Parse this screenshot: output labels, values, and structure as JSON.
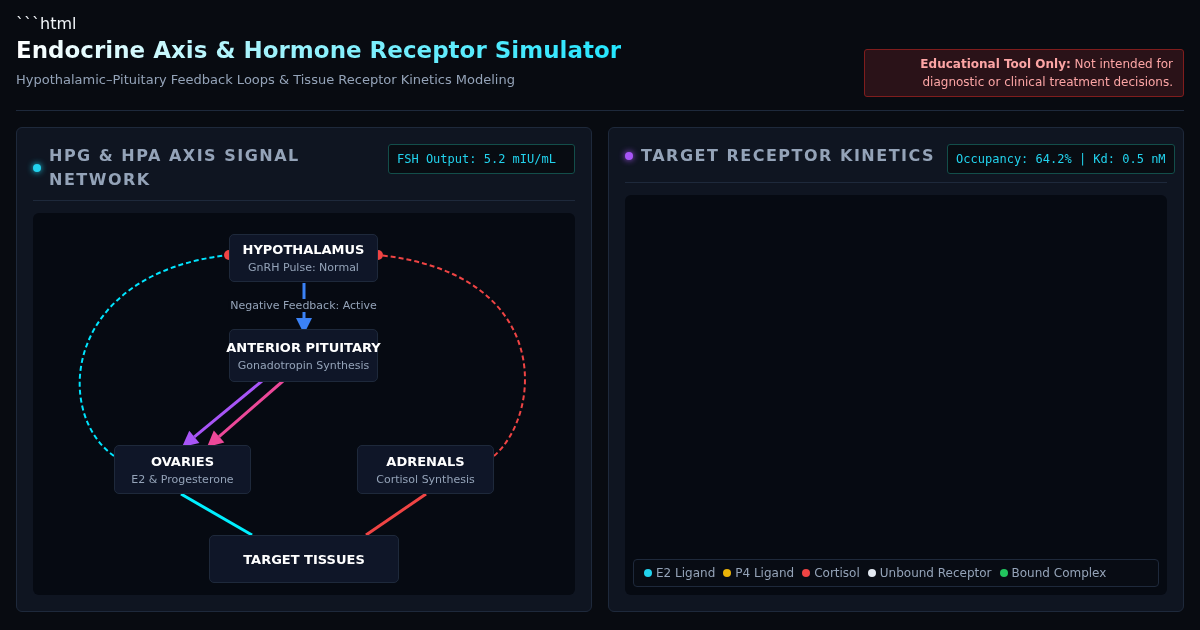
{
  "code_fence": "```html",
  "header": {
    "title_lead": "Endocrine",
    "title_rest": "Axis & Hormone Receptor Simulator",
    "subtitle": "Hypothalamic–Pituitary Feedback Loops & Tissue Receptor Kinetics Modeling",
    "disclaimer": "**Educational Tool Only:** Not intended for diagnostic or clinical treatment decisions."
  },
  "panels": [
    {
      "kind": "network",
      "title": "HPG & HPA AXIS SIGNAL NETWORK",
      "color": "#22d3ee",
      "readout": "FSH Output: 5.2 mIU/mL",
      "nodes": [
        {
          "title": "HYPOTHALAMUS",
          "subtitle": "GnRH Pulse: Normal"
        },
        {
          "title": "ANTERIOR PITUITARY",
          "subtitle": "Gonadotropin Synthesis"
        },
        {
          "title": "OVARIES",
          "subtitle": "E2 & Progesterone"
        },
        {
          "title": "ADRENALS",
          "subtitle": "Cortisol Synthesis"
        },
        {
          "title": "TARGET TISSUES"
        }
      ],
      "edges": [
        {
          "kind": "arrow",
          "color": "#3b82f6"
        },
        {
          "kind": "arrow",
          "color": "#a855f7"
        },
        {
          "kind": "arrow",
          "color": "#ec4899"
        },
        {
          "kind": "line",
          "color": "#00f0ff"
        },
        {
          "kind": "line",
          "color": "#ef4444"
        },
        {
          "kind": "feedback",
          "color": "#00e5ff"
        },
        {
          "kind": "feedback",
          "color": "#ef4444"
        }
      ],
      "feedback_label": "Negative Feedback: Active"
    },
    {
      "kind": "kinetics",
      "title": "TARGET RECEPTOR KINETICS",
      "color": "#a855f7",
      "readout": "Occupancy: 64.2% | Kd: 0.5 nM",
      "legend": [
        {
          "label": "E2 Ligand",
          "color": "#22d3ee"
        },
        {
          "label": "P4 Ligand",
          "color": "#eab308"
        },
        {
          "label": "Cortisol",
          "color": "#ef4444"
        },
        {
          "label": "Unbound Receptor",
          "color": "#e2e8f0"
        },
        {
          "label": "Bound Complex",
          "color": "#22c55e"
        }
      ]
    }
  ]
}
